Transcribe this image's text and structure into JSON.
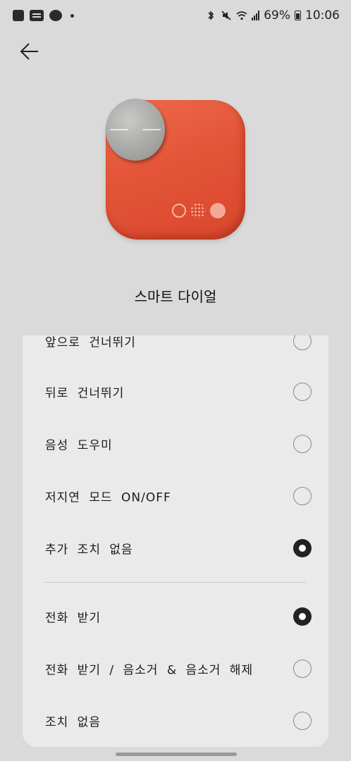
{
  "status_bar": {
    "time": "10:06",
    "battery": "69%",
    "icons": [
      "gallery-icon",
      "webtoon-icon",
      "chat-icon",
      "notification-dot",
      "bluetooth-icon",
      "mute-icon",
      "wifi-icon",
      "signal-icon",
      "battery-icon"
    ]
  },
  "header": {
    "back_icon": "arrow-left-icon"
  },
  "device": {
    "name": "스마트 다이얼",
    "colors": {
      "body": "#e45538",
      "knob": "#a8a8a6",
      "accent": "#f4a896"
    }
  },
  "options": {
    "group1": [
      {
        "label": "앞으로 건너뛰기",
        "selected": false
      },
      {
        "label": "뒤로 건너뛰기",
        "selected": false
      },
      {
        "label": "음성 도우미",
        "selected": false
      },
      {
        "label": "저지연 모드 ON/OFF",
        "selected": false
      },
      {
        "label": "추가 조치 없음",
        "selected": true
      }
    ],
    "group2": [
      {
        "label": "전화 받기",
        "selected": true
      },
      {
        "label": "전화 받기 / 음소거 & 음소거 해제",
        "selected": false
      },
      {
        "label": "조치 없음",
        "selected": false
      }
    ]
  }
}
